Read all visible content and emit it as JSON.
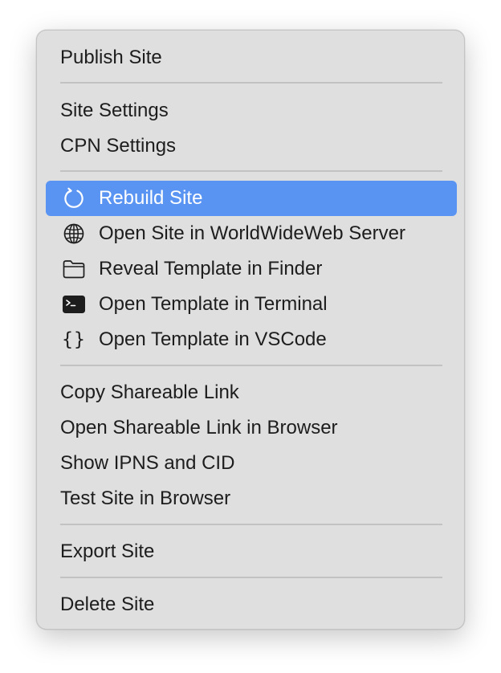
{
  "menu": {
    "publish_site": "Publish Site",
    "site_settings": "Site Settings",
    "cpn_settings": "CPN Settings",
    "rebuild_site": "Rebuild Site",
    "open_site_in_server": "Open Site in WorldWideWeb Server",
    "reveal_template_in_finder": "Reveal Template in Finder",
    "open_template_in_terminal": "Open Template in Terminal",
    "open_template_in_vscode": "Open Template in VSCode",
    "copy_shareable_link": "Copy Shareable Link",
    "open_shareable_link_in_browser": "Open Shareable Link in Browser",
    "show_ipns_and_cid": "Show IPNS and CID",
    "test_site_in_browser": "Test Site in Browser",
    "export_site": "Export Site",
    "delete_site": "Delete Site"
  },
  "icons": {
    "rebuild": "refresh-icon",
    "open_server": "globe-icon",
    "reveal_finder": "folder-icon",
    "terminal": "terminal-icon",
    "vscode": "curly-braces-icon",
    "vscode_glyph": "{}"
  },
  "colors": {
    "menu_background": "#dfdfdf",
    "highlight": "#5a94f2",
    "text": "#1d1d1d",
    "separator": "#c2c2c2"
  }
}
